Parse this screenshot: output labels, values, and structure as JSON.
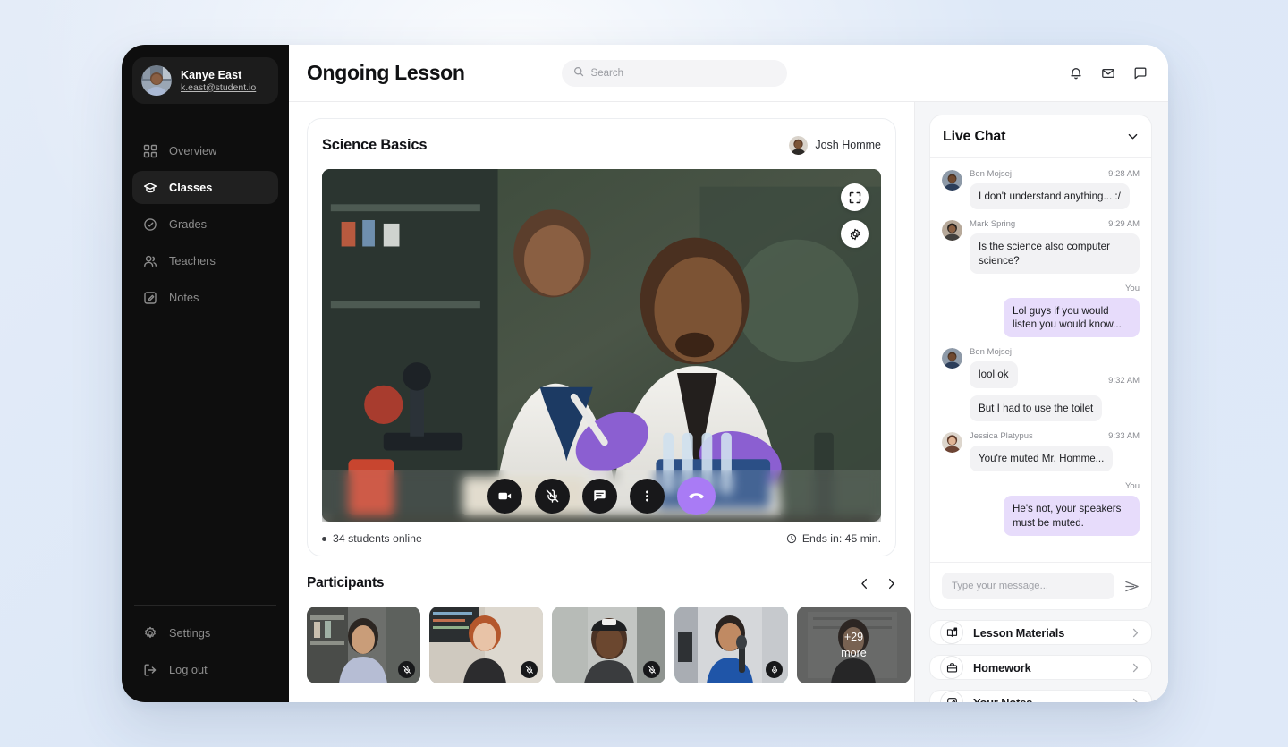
{
  "theme": {
    "page_bg": "#e1eaf7",
    "sidebar_bg": "#0e0e0e",
    "accent_purple": "#a97bf5",
    "bubble_out": "#e7dcfb",
    "active_tile_border": "#5ed6bb"
  },
  "sidebar": {
    "profile": {
      "name": "Kanye East",
      "email": "k.east@student.io",
      "avatar_icon": "user-avatar"
    },
    "items": [
      {
        "label": "Overview",
        "icon": "grid-icon",
        "active": false
      },
      {
        "label": "Classes",
        "icon": "graduation-cap-icon",
        "active": true
      },
      {
        "label": "Grades",
        "icon": "check-badge-icon",
        "active": false
      },
      {
        "label": "Teachers",
        "icon": "users-icon",
        "active": false
      },
      {
        "label": "Notes",
        "icon": "note-edit-icon",
        "active": false
      }
    ],
    "bottom_items": [
      {
        "label": "Settings",
        "icon": "gear-icon"
      },
      {
        "label": "Log out",
        "icon": "logout-icon"
      }
    ]
  },
  "topbar": {
    "title": "Ongoing Lesson",
    "search": {
      "value": "",
      "placeholder": "Search",
      "icon": "search-icon"
    },
    "icons": [
      {
        "name": "bell-icon"
      },
      {
        "name": "mail-icon"
      },
      {
        "name": "chat-icon"
      }
    ]
  },
  "lesson": {
    "title": "Science Basics",
    "teacher": "Josh Homme",
    "video_overlay_buttons": [
      {
        "name": "fullscreen-icon"
      },
      {
        "name": "settings-gear-icon"
      }
    ],
    "controls": [
      {
        "name": "camera-icon",
        "label": "Camera"
      },
      {
        "name": "mic-muted-icon",
        "label": "Microphone muted"
      },
      {
        "name": "chat-icon",
        "label": "Chat"
      },
      {
        "name": "more-options-icon",
        "label": "More"
      },
      {
        "name": "end-call-icon",
        "label": "End call"
      }
    ],
    "status_left": "34 students online",
    "status_right": "Ends in: 45 min.",
    "status_right_icon": "clock-icon"
  },
  "participants": {
    "title": "Participants",
    "prev_icon": "chevron-left-icon",
    "next_icon": "chevron-right-icon",
    "tiles": [
      {
        "muted": true,
        "active": false,
        "overlay": ""
      },
      {
        "muted": true,
        "active": false,
        "overlay": ""
      },
      {
        "muted": true,
        "active": false,
        "overlay": ""
      },
      {
        "muted": false,
        "active": true,
        "overlay": ""
      },
      {
        "muted": false,
        "active": false,
        "overlay": "+29\nmore"
      }
    ],
    "more_label_line1": "+29",
    "more_label_line2": "more"
  },
  "chat": {
    "title": "Live Chat",
    "collapse_icon": "chevron-down-icon",
    "messages": [
      {
        "side": "in",
        "author": "Ben Mojsej",
        "time": "9:28 AM",
        "text": "I don't understand anything... :/"
      },
      {
        "side": "in",
        "author": "Mark Spring",
        "time": "9:29 AM",
        "text": "Is the science also computer science?"
      },
      {
        "side": "out",
        "author": "You",
        "time": "",
        "text": "Lol guys if you would listen you would know..."
      },
      {
        "side": "in",
        "author": "Ben Mojsej",
        "time": "9:32 AM",
        "text": "lool ok",
        "text2": "But I had to use the toilet"
      },
      {
        "side": "in",
        "author": "Jessica Platypus",
        "time": "9:33 AM",
        "text": "You're muted Mr. Homme..."
      },
      {
        "side": "out",
        "author": "You",
        "time": "",
        "text": "He's not, your speakers must be muted."
      }
    ],
    "input": {
      "value": "",
      "placeholder": "Type your message..."
    },
    "send_icon": "send-icon"
  },
  "actions": [
    {
      "label": "Lesson Materials",
      "icon": "book-icon",
      "chevron": "chevron-right-icon"
    },
    {
      "label": "Homework",
      "icon": "briefcase-icon",
      "chevron": "chevron-right-icon"
    },
    {
      "label": "Your Notes",
      "icon": "note-edit-icon",
      "chevron": "chevron-right-icon"
    }
  ]
}
